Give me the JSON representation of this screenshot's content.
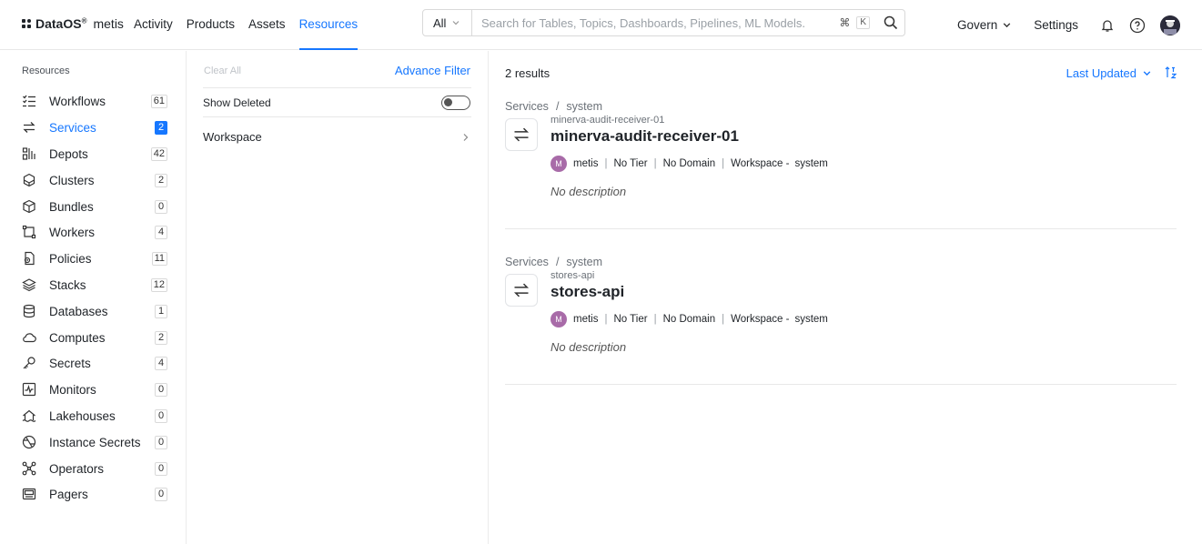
{
  "brand": {
    "name": "DataOS",
    "sup": "®",
    "sub": "metis"
  },
  "nav": {
    "items": [
      "Activity",
      "Products",
      "Assets",
      "Resources"
    ],
    "active": "Resources"
  },
  "search": {
    "type": "All",
    "placeholder": "Search for Tables, Topics, Dashboards, Pipelines, ML Models.",
    "shortcut_cmd": "⌘",
    "shortcut_key": "K"
  },
  "right_nav": {
    "govern": "Govern",
    "settings": "Settings"
  },
  "sidebar": {
    "title": "Resources",
    "items": [
      {
        "label": "Workflows",
        "count": "61",
        "icon": "workflow-icon",
        "active": false
      },
      {
        "label": "Services",
        "count": "2",
        "icon": "service-icon",
        "active": true
      },
      {
        "label": "Depots",
        "count": "42",
        "icon": "depot-icon",
        "active": false
      },
      {
        "label": "Clusters",
        "count": "2",
        "icon": "cluster-icon",
        "active": false
      },
      {
        "label": "Bundles",
        "count": "0",
        "icon": "bundle-icon",
        "active": false
      },
      {
        "label": "Workers",
        "count": "4",
        "icon": "worker-icon",
        "active": false
      },
      {
        "label": "Policies",
        "count": "11",
        "icon": "policy-icon",
        "active": false
      },
      {
        "label": "Stacks",
        "count": "12",
        "icon": "stack-icon",
        "active": false
      },
      {
        "label": "Databases",
        "count": "1",
        "icon": "database-icon",
        "active": false
      },
      {
        "label": "Computes",
        "count": "2",
        "icon": "compute-icon",
        "active": false
      },
      {
        "label": "Secrets",
        "count": "4",
        "icon": "secret-icon",
        "active": false
      },
      {
        "label": "Monitors",
        "count": "0",
        "icon": "monitor-icon",
        "active": false
      },
      {
        "label": "Lakehouses",
        "count": "0",
        "icon": "lakehouse-icon",
        "active": false
      },
      {
        "label": "Instance Secrets",
        "count": "0",
        "icon": "instance-secret-icon",
        "active": false
      },
      {
        "label": "Operators",
        "count": "0",
        "icon": "operator-icon",
        "active": false
      },
      {
        "label": "Pagers",
        "count": "0",
        "icon": "pager-icon",
        "active": false
      }
    ]
  },
  "filters": {
    "clear_all": "Clear All",
    "advance_filter": "Advance Filter",
    "show_deleted": "Show Deleted",
    "show_deleted_on": false,
    "workspace": "Workspace"
  },
  "results": {
    "count_label": "2 results",
    "sort_label": "Last Updated",
    "cards": [
      {
        "crumb_type": "Services",
        "crumb_sep": "/",
        "crumb_ws": "system",
        "subtitle": "minerva-audit-receiver-01",
        "title": "minerva-audit-receiver-01",
        "owner_initial": "M",
        "owner": "metis",
        "tier": "No Tier",
        "domain": "No Domain",
        "workspace_label": "Workspace -",
        "workspace": "system",
        "description": "No description"
      },
      {
        "crumb_type": "Services",
        "crumb_sep": "/",
        "crumb_ws": "system",
        "subtitle": "stores-api",
        "title": "stores-api",
        "owner_initial": "M",
        "owner": "metis",
        "tier": "No Tier",
        "domain": "No Domain",
        "workspace_label": "Workspace -",
        "workspace": "system",
        "description": "No description"
      }
    ]
  },
  "colors": {
    "accent": "#1677ff",
    "owner_badge": "#a86ba8"
  }
}
